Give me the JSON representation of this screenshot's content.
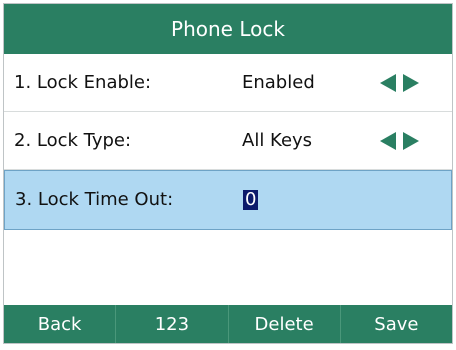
{
  "title": "Phone Lock",
  "rows": [
    {
      "label": "1. Lock Enable:",
      "value": "Enabled"
    },
    {
      "label": "2. Lock Type:",
      "value": "All Keys"
    },
    {
      "label": "3. Lock Time Out:",
      "value": "0"
    }
  ],
  "softkeys": [
    "Back",
    "123",
    "Delete",
    "Save"
  ],
  "colors": {
    "accent": "#2a7f62",
    "selected_row": "#afd8f2",
    "cursor": "#0b1a6b"
  },
  "icons": {
    "prev": "arrow-left-icon",
    "next": "arrow-right-icon"
  }
}
